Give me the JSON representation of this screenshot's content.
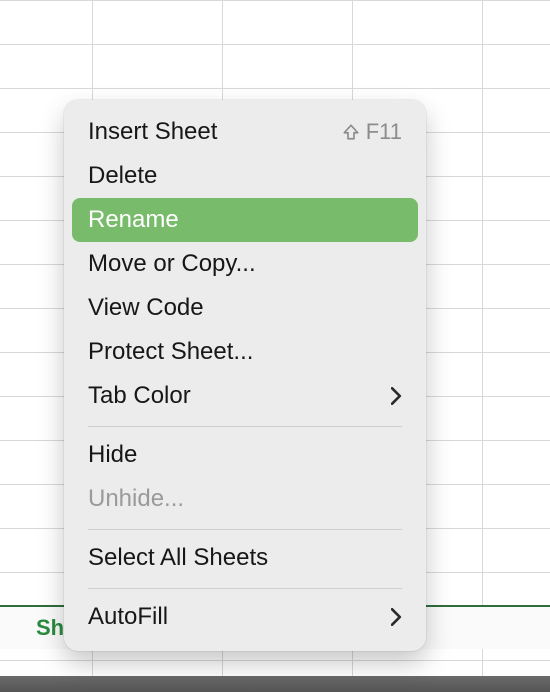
{
  "sheet_bar": {
    "active_tab_label": "Sh"
  },
  "menu": {
    "items": [
      {
        "label": "Insert Sheet",
        "shortcut": "F11",
        "has_upshift": true
      },
      {
        "label": "Delete"
      },
      {
        "label": "Rename",
        "highlighted": true
      },
      {
        "label": "Move or Copy..."
      },
      {
        "label": "View Code"
      },
      {
        "label": "Protect Sheet..."
      },
      {
        "label": "Tab Color",
        "submenu": true
      },
      {
        "label": "Hide"
      },
      {
        "label": "Unhide...",
        "disabled": true
      },
      {
        "label": "Select All Sheets"
      },
      {
        "label": "AutoFill",
        "submenu": true
      }
    ]
  }
}
